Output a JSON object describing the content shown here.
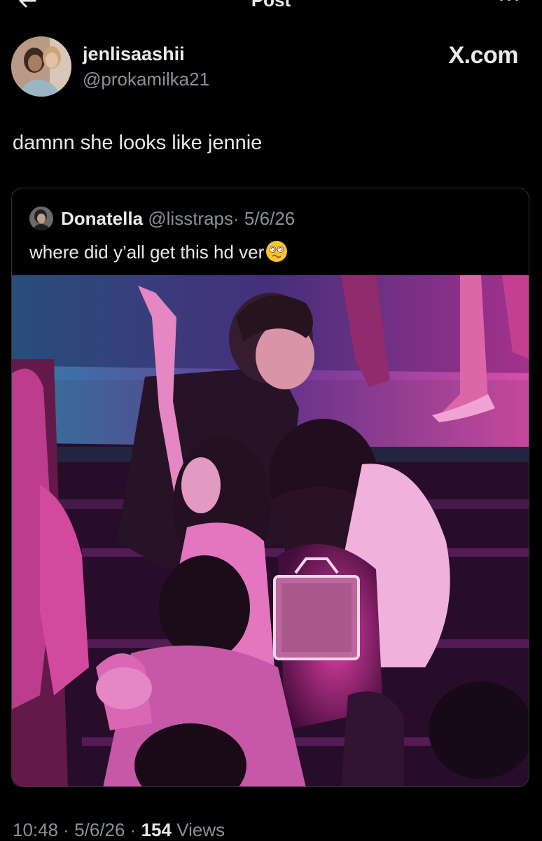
{
  "header": {
    "title": "Post"
  },
  "tweet": {
    "author_name": "jenlisaashii",
    "author_handle": "@prokamilka21",
    "source_badge": "X.com",
    "text": "damnn she looks like jennie"
  },
  "quote": {
    "name": "Donatella",
    "handle": "@lisstraps",
    "separator": "·",
    "date": "5/6/26",
    "text": "where did y’all get this hd ver"
  },
  "footer": {
    "time": "10:48",
    "sep1": " · ",
    "date": "5/6/26",
    "sep2": " · ",
    "views_count": "154",
    "views_label": " Views"
  },
  "colors": {
    "background": "#000000",
    "text": "#e7e9ea",
    "muted": "#8b9196",
    "border": "#2f3336"
  }
}
